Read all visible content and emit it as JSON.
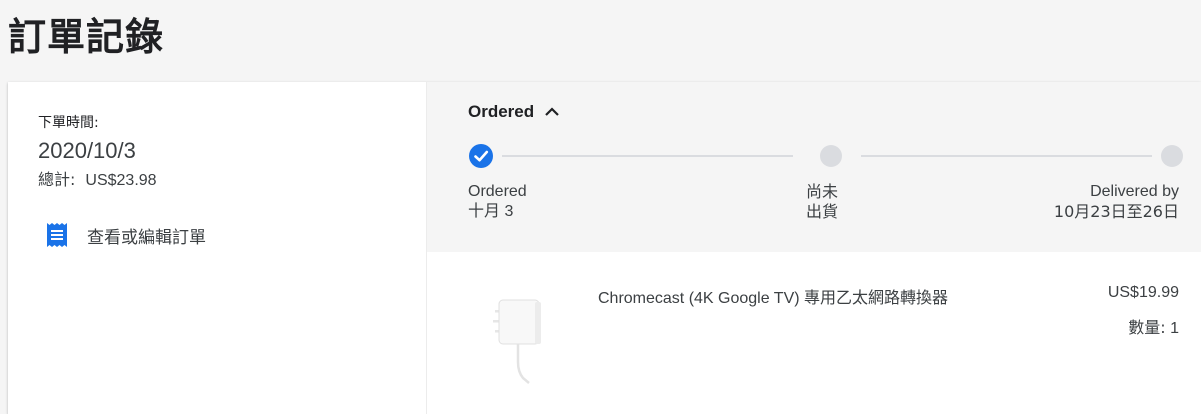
{
  "page": {
    "title": "訂單記錄"
  },
  "order": {
    "date_label": "下單時間:",
    "date": "2020/10/3",
    "total_label": "總計:",
    "total_value": "US$23.98",
    "view_edit_label": "查看或編輯訂單",
    "view_edit_icon": "receipt-icon"
  },
  "status": {
    "header": "Ordered",
    "toggle_icon": "chevron-up-icon",
    "accent_color": "#1a73e8",
    "steps": [
      {
        "line1": "Ordered",
        "line2": "十月 3",
        "state": "done"
      },
      {
        "line1": "尚未",
        "line2": "出貨",
        "state": "pending"
      },
      {
        "line1": "Delivered by",
        "line2": "10月23日至26日",
        "state": "pending"
      }
    ]
  },
  "item": {
    "name_en": "Chromecast (4K Google TV) ",
    "name_zh": "專用乙太網路轉換器",
    "price": "US$19.99",
    "qty_label": "數量:",
    "qty_value": "1",
    "image_icon": "power-adapter-icon"
  }
}
